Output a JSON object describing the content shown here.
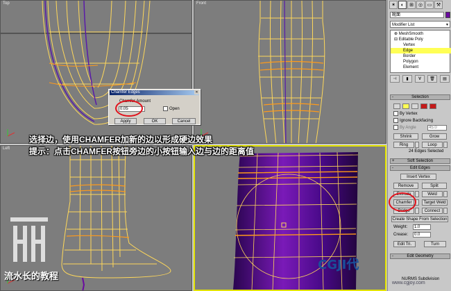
{
  "viewports": {
    "top": {
      "label": "Top"
    },
    "front": {
      "label": "Front"
    },
    "left": {
      "label": "Left"
    },
    "perspective": {
      "label": ""
    }
  },
  "annotations": {
    "line1": "选择边，使用CHAMFER加新的边以形成硬边效果",
    "line2": "提示：点击CHAMFER按钮旁边的小按钮输入边与边的距离值"
  },
  "dialog": {
    "title": "Chamfer Edges",
    "amount_label": "Chamfer Amount",
    "amount_value": "0.05",
    "open_label": "Open",
    "apply": "Apply",
    "ok": "OK",
    "cancel": "Cancel"
  },
  "panel": {
    "object_name": "靴面",
    "object_color": "#6a0aa0",
    "modifier_list": "Modifier List",
    "stack": [
      {
        "label": "MeshSmooth",
        "level": 0
      },
      {
        "label": "Editable Poly",
        "level": 0
      },
      {
        "label": "Vertex",
        "level": 1
      },
      {
        "label": "Edge",
        "level": 1,
        "selected": true
      },
      {
        "label": "Border",
        "level": 1
      },
      {
        "label": "Polygon",
        "level": 1
      },
      {
        "label": "Element",
        "level": 1
      }
    ],
    "selection": {
      "title": "Selection",
      "by_vertex": "By Vertex",
      "ignore_backfacing": "Ignore Backfacing",
      "by_angle": "By Angle",
      "angle_value": "45.0",
      "shrink": "Shrink",
      "grow": "Grow",
      "ring": "Ring",
      "loop": "Loop",
      "status": "24 Edges Selected"
    },
    "soft_selection": {
      "title": "Soft Selection"
    },
    "edit_edges": {
      "title": "Edit Edges",
      "insert_vertex": "Insert Vertex",
      "remove": "Remove",
      "split": "Split",
      "extrude": "Extrude",
      "weld": "Weld",
      "chamfer": "Chamfer",
      "target_weld": "Target Weld",
      "bridge": "Bridge",
      "connect": "Connect",
      "create_shape": "Create Shape From Selection",
      "weight_label": "Weight:",
      "weight_value": "1.0",
      "crease_label": "Crease:",
      "crease_value": "0.0",
      "edit_tri": "Edit Tri.",
      "turn": "Turn"
    },
    "edit_geometry": {
      "title": "Edit Geometry",
      "nurms": "NURMS Subdivision"
    }
  },
  "watermark": {
    "author": "流水长的教程",
    "brand": "CGJI代",
    "url": "www.cgjoy.com"
  },
  "colors": {
    "viewport_bg": "#7d7d7d",
    "wire_yellow": "#ffd85a",
    "wire_orange": "#ff9a1a",
    "wire_purple": "#5a1aa8",
    "highlight_red": "#e0101a"
  }
}
